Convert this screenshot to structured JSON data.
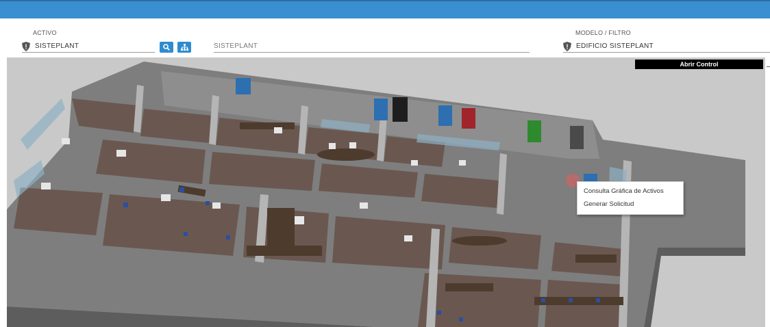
{
  "header": {
    "bar_color": "#3a8fd0"
  },
  "activo": {
    "label": "ACTIVO",
    "value": "SISTEPLANT",
    "icon": "shield-icon",
    "search_button_icon": "search-icon",
    "tree_button_icon": "hierarchy-icon"
  },
  "description": {
    "value": "SISTEPLANT"
  },
  "modelo": {
    "label": "MODELO / FILTRO",
    "value": "EDIFICIO SISTEPLANT",
    "icon": "shield-icon"
  },
  "viewer": {
    "open_control_label": "Abrir Control",
    "context_menu": [
      {
        "label": "Consulta Gráfica de Activos"
      },
      {
        "label": "Generar Solicitud"
      }
    ],
    "background": "#c9c9c9",
    "accent": "#2f8bd0"
  }
}
